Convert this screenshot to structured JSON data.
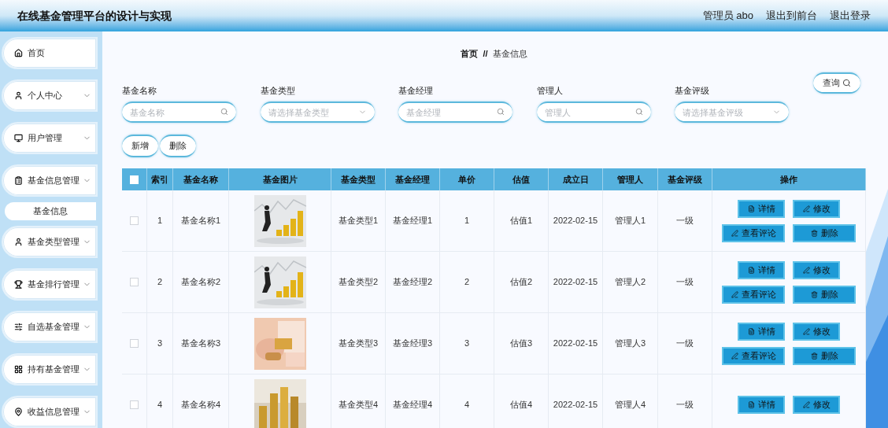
{
  "header": {
    "title": "在线基金管理平台的设计与实现",
    "links": [
      "管理员 abo",
      "退出到前台",
      "退出登录"
    ]
  },
  "sidebar": {
    "items": [
      {
        "label": "首页",
        "kind": "link",
        "selected": false
      },
      {
        "label": "个人中心",
        "kind": "group",
        "selected": false
      },
      {
        "label": "用户管理",
        "kind": "group",
        "selected": false
      },
      {
        "label": "基金信息管理",
        "kind": "group",
        "selected": false
      },
      {
        "label": "基金信息",
        "kind": "sub",
        "selected": true
      },
      {
        "label": "基金类型管理",
        "kind": "group",
        "selected": false
      },
      {
        "label": "基金排行管理",
        "kind": "group",
        "selected": false
      },
      {
        "label": "自选基金管理",
        "kind": "group",
        "selected": false
      },
      {
        "label": "持有基金管理",
        "kind": "group",
        "selected": false
      },
      {
        "label": "收益信息管理",
        "kind": "group",
        "selected": false
      }
    ]
  },
  "breadcrumb": [
    "首页",
    "//",
    "基金信息"
  ],
  "filters": [
    {
      "label": "基金名称",
      "placeholder": "基金名称",
      "kind": "text"
    },
    {
      "label": "基金类型",
      "placeholder": "请选择基金类型",
      "kind": "select"
    },
    {
      "label": "基金经理",
      "placeholder": "基金经理",
      "kind": "text"
    },
    {
      "label": "管理人",
      "placeholder": "管理人",
      "kind": "text"
    },
    {
      "label": "基金评级",
      "placeholder": "请选择基金评级",
      "kind": "select"
    }
  ],
  "query_button": "查询",
  "toolbar": [
    "新增",
    "删除"
  ],
  "table": {
    "header_checked": false,
    "columns": [
      "索引",
      "基金名称",
      "基金图片",
      "基金类型",
      "基金经理",
      "单价",
      "估值",
      "成立日",
      "管理人",
      "基金评级",
      "操作"
    ],
    "rows": [
      {
        "checked": false,
        "cells": [
          "1",
          "基金名称1",
          "",
          "基金类型1",
          "基金经理1",
          "1",
          "估值1",
          "2022-02-15",
          "管理人1",
          "一级"
        ],
        "actions": [
          "详情",
          "修改",
          "查看评论",
          "删除"
        ]
      },
      {
        "checked": false,
        "cells": [
          "2",
          "基金名称2",
          "",
          "基金类型2",
          "基金经理2",
          "2",
          "估值2",
          "2022-02-15",
          "管理人2",
          "一级"
        ],
        "actions": [
          "详情",
          "修改",
          "查看评论",
          "删除"
        ]
      },
      {
        "checked": false,
        "cells": [
          "3",
          "基金名称3",
          "",
          "基金类型3",
          "基金经理3",
          "3",
          "估值3",
          "2022-02-15",
          "管理人3",
          "一级"
        ],
        "actions": [
          "详情",
          "修改",
          "查看评论",
          "删除"
        ]
      },
      {
        "checked": false,
        "cells": [
          "4",
          "基金名称4",
          "",
          "基金类型4",
          "基金经理4",
          "4",
          "估值4",
          "2022-02-15",
          "管理人4",
          "一级"
        ],
        "actions": [
          "详情",
          "修改"
        ]
      }
    ]
  }
}
